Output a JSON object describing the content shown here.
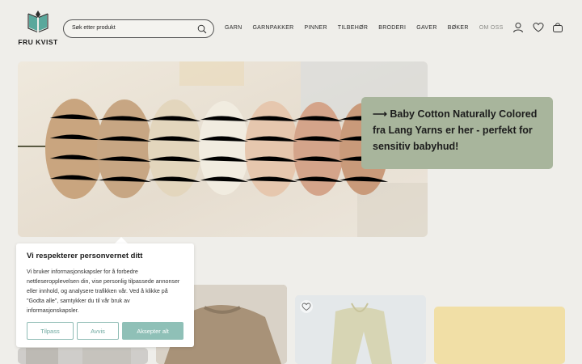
{
  "brand": {
    "name": "FRU KVIST",
    "mark_color": "#5aa89c"
  },
  "search": {
    "placeholder": "Søk etter produkt"
  },
  "nav": {
    "items": [
      "GARN",
      "GARNPAKKER",
      "PINNER",
      "TILBEHØR",
      "BRODERI",
      "GAVER",
      "BØKER",
      "OM OSS"
    ]
  },
  "header_icons": [
    "account-icon",
    "wishlist-heart-icon",
    "bag-icon"
  ],
  "hero": {
    "arrow": "⟶",
    "text": "Baby Cotton Naturally Colored fra Lang Yarns er her - perfekt for sensitiv babyhud!"
  },
  "cookie": {
    "title": "Vi respekterer personvernet ditt",
    "body": "Vi bruker informasjonskapsler for å forbedre nettleseropplevelsen din, vise personlig tilpassede annonser eller innhold, og analysere trafikken vår. Ved å klikke på \"Godta alle\", samtykker du til vår bruk av informasjonskapsler.",
    "customize_label": "Tilpass",
    "reject_label": "Avvis",
    "accept_label": "Aksepter alt"
  },
  "colors": {
    "accent": "#8fc0b7",
    "callout_bg": "#a8b59c",
    "yellow_card": "#f1dfa6"
  }
}
